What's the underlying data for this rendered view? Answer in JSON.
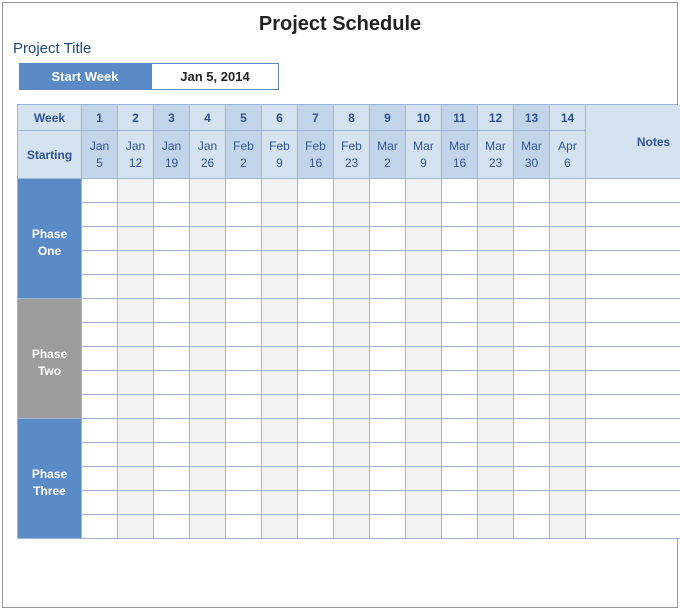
{
  "title": "Project Schedule",
  "projectTitle": "Project Title",
  "startWeek": {
    "label": "Start Week",
    "value": "Jan 5, 2014"
  },
  "header": {
    "weekLabel": "Week",
    "startingLabel": "Starting",
    "notesLabel": "Notes",
    "weeks": [
      "1",
      "2",
      "3",
      "4",
      "5",
      "6",
      "7",
      "8",
      "9",
      "10",
      "11",
      "12",
      "13",
      "14"
    ],
    "dates": [
      {
        "m": "Jan",
        "d": "5"
      },
      {
        "m": "Jan",
        "d": "12"
      },
      {
        "m": "Jan",
        "d": "19"
      },
      {
        "m": "Jan",
        "d": "26"
      },
      {
        "m": "Feb",
        "d": "2"
      },
      {
        "m": "Feb",
        "d": "9"
      },
      {
        "m": "Feb",
        "d": "16"
      },
      {
        "m": "Feb",
        "d": "23"
      },
      {
        "m": "Mar",
        "d": "2"
      },
      {
        "m": "Mar",
        "d": "9"
      },
      {
        "m": "Mar",
        "d": "16"
      },
      {
        "m": "Mar",
        "d": "23"
      },
      {
        "m": "Mar",
        "d": "30"
      },
      {
        "m": "Apr",
        "d": "6"
      }
    ]
  },
  "phases": [
    {
      "line1": "Phase",
      "line2": "One"
    },
    {
      "line1": "Phase",
      "line2": "Two"
    },
    {
      "line1": "Phase",
      "line2": "Three"
    }
  ]
}
